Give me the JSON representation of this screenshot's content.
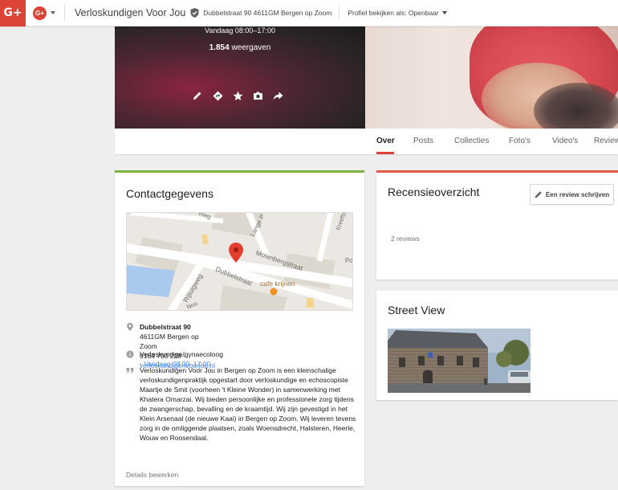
{
  "topbar": {
    "logo": "G+",
    "switcher_letter": "G+",
    "page_name": "Verloskundigen Voor Jou",
    "address": "Dubbelstraat 90 4611GM Bergen op Zoom",
    "view_as": "Profiel bekijken als: Openbaar"
  },
  "cover": {
    "hours": "Vandaag 08:00–17:00",
    "views_count": "1.854",
    "views_label": "weergaven",
    "actions": [
      "pencil-icon",
      "directions-icon",
      "star-icon",
      "camera-icon",
      "share-icon"
    ]
  },
  "tabs": [
    {
      "label": "Over",
      "active": true
    },
    {
      "label": "Posts"
    },
    {
      "label": "Collecties"
    },
    {
      "label": "Foto's"
    },
    {
      "label": "Video's"
    },
    {
      "label": "Review"
    }
  ],
  "contact": {
    "title": "Contactgegevens",
    "map_labels": {
      "molenbergstraat": "Molenbergstraat",
      "dubbelstraat": "Dubbelstraat",
      "rijtuigweg": "Rijtuigweg",
      "lange": "Lange P",
      "cafe": "cafe krijnen",
      "vlieg": "Vlieg",
      "noor": "Noo",
      "po": "Po",
      "kreeft": "Kreeftstr"
    },
    "address_bold": "Dubbelstraat 90",
    "address_rest": "4611GM Bergen op Zoom",
    "phone": "0164 700 229",
    "separator": "·",
    "website": "verloskundigenvoorjou.nl",
    "category": "Verloskundige/gynaecoloog",
    "hours": "Vandaag 08:00–17:00",
    "description": "Verloskundigen Voor Jou in Bergen op Zoom is een kleinschalige verloskundigenpraktijk opgestart door verloskundige en echoscopiste Maartje de Smit (voorheen 't Kleine Wonder) in samenwerking met Khatera Omarzai. Wij bieden persoonlijke en professionele zorg tijdens de zwangerschap, bevalling en de kraamtijd. Wij zijn gevestigd in het Klein Arsenaal (de nieuwe Kaai) in Bergen op Zoom. Wij leveren tevens zorg in de omliggende plaatsen, zoals Woensdrecht, Halsteren, Heerle, Wouw en Roosendaal.",
    "edit_link": "Details bewerken"
  },
  "reviews": {
    "title": "Recensieoverzicht",
    "write_button": "Een review schrijven",
    "count": "2 reviews"
  },
  "street_view": {
    "title": "Street View"
  },
  "colors": {
    "brand_red": "#db4437",
    "link_blue": "#4285f4",
    "contact_accent": "#7cb342",
    "review_accent": "#e05a48"
  }
}
